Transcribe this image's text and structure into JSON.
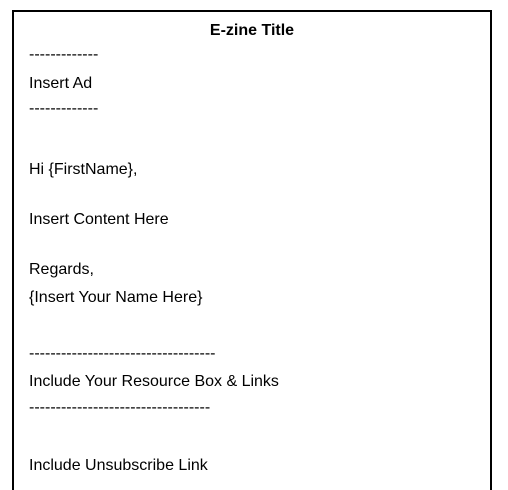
{
  "document": {
    "title": "E-zine Title",
    "ad_divider_top": "-------------",
    "ad_text": "Insert Ad",
    "ad_divider_bottom": "-------------",
    "greeting": "Hi {FirstName},",
    "content": "Insert Content Here",
    "closing": "Regards,",
    "signature": "{Insert Your Name Here}",
    "resource_divider_top": "-----------------------------------",
    "resource_text": "Include Your Resource Box & Links",
    "resource_divider_bottom": "----------------------------------",
    "unsubscribe": "Include Unsubscribe Link"
  }
}
